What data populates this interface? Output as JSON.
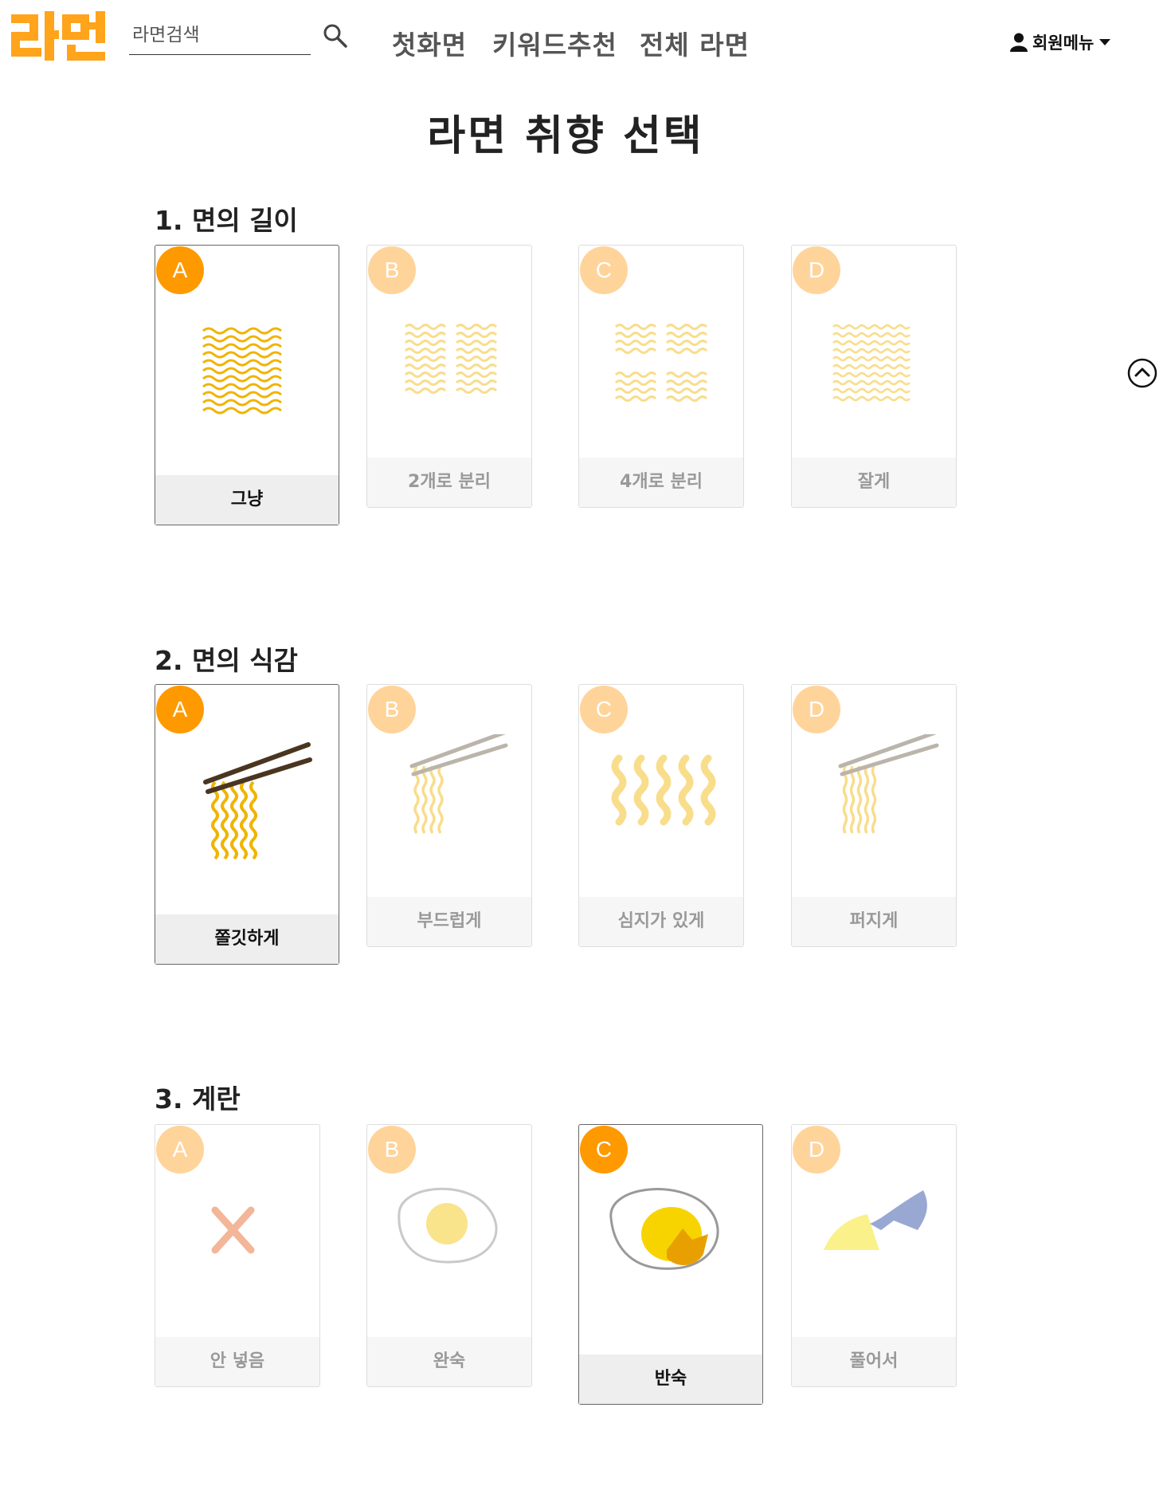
{
  "header": {
    "logo_text": "라면",
    "search_placeholder": "라면검색",
    "nav": [
      "첫화면",
      "키워드추천",
      "전체 라면"
    ],
    "user_menu": "회원메뉴"
  },
  "page_title": "라면 취향 선택",
  "sections": [
    {
      "title": "1. 면의 길이",
      "options": [
        {
          "letter": "A",
          "label": "그냥",
          "selected": true
        },
        {
          "letter": "B",
          "label": "2개로 분리",
          "selected": false
        },
        {
          "letter": "C",
          "label": "4개로 분리",
          "selected": false
        },
        {
          "letter": "D",
          "label": "잘게",
          "selected": false
        }
      ]
    },
    {
      "title": "2. 면의 식감",
      "options": [
        {
          "letter": "A",
          "label": "쫄깃하게",
          "selected": true
        },
        {
          "letter": "B",
          "label": "부드럽게",
          "selected": false
        },
        {
          "letter": "C",
          "label": "심지가 있게",
          "selected": false
        },
        {
          "letter": "D",
          "label": "퍼지게",
          "selected": false
        }
      ]
    },
    {
      "title": "3. 계란",
      "options": [
        {
          "letter": "A",
          "label": "안 넣음",
          "selected": false
        },
        {
          "letter": "B",
          "label": "완숙",
          "selected": false
        },
        {
          "letter": "C",
          "label": "반숙",
          "selected": true
        },
        {
          "letter": "D",
          "label": "풀어서",
          "selected": false
        }
      ]
    }
  ],
  "colors": {
    "accent": "#ff9900",
    "badge_muted": "#ffd49a",
    "noodle": "#f2b705"
  }
}
